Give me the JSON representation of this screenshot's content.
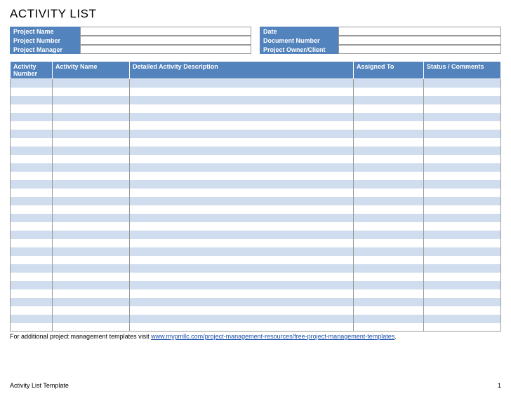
{
  "title": "ACTIVITY LIST",
  "meta": {
    "left": [
      {
        "label": "Project Name",
        "value": ""
      },
      {
        "label": "Project Number",
        "value": ""
      },
      {
        "label": "Project Manager",
        "value": ""
      }
    ],
    "right": [
      {
        "label": "Date",
        "value": ""
      },
      {
        "label": "Document Number",
        "value": ""
      },
      {
        "label": "Project Owner/Client",
        "value": ""
      }
    ]
  },
  "columns": {
    "number": "Activity Number",
    "name": "Activity Name",
    "description": "Detailed Activity Description",
    "assigned": "Assigned To",
    "status": "Status / Comments"
  },
  "row_count": 30,
  "footnote_prefix": "For additional project management templates visit ",
  "footnote_link_text": "www.mypmllc.com/project-management-resources/free-project-management-templates",
  "footnote_suffix": ".",
  "footer_left": "Activity List Template",
  "footer_right": "1"
}
